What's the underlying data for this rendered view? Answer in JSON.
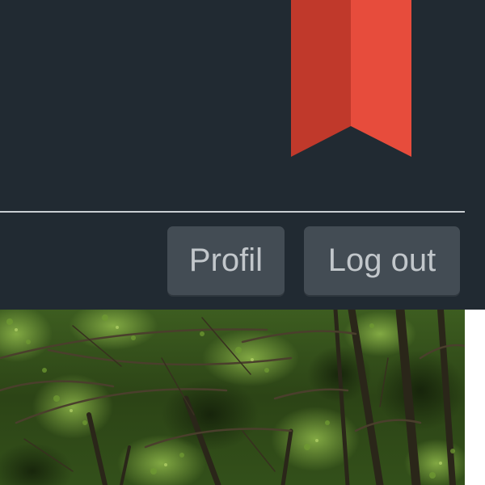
{
  "header": {
    "background_color": "#212a32",
    "bookmark": {
      "icon": "bookmark-ribbon",
      "color_left": "#c0392b",
      "color_right": "#e74c3c"
    }
  },
  "nav": {
    "profile_label": "Profil",
    "logout_label": "Log out",
    "button_color": "#434c54",
    "button_text_color": "#c2c7cb"
  },
  "hero": {
    "image": "forest-canopy",
    "dominant_color": "#2f4a18"
  }
}
